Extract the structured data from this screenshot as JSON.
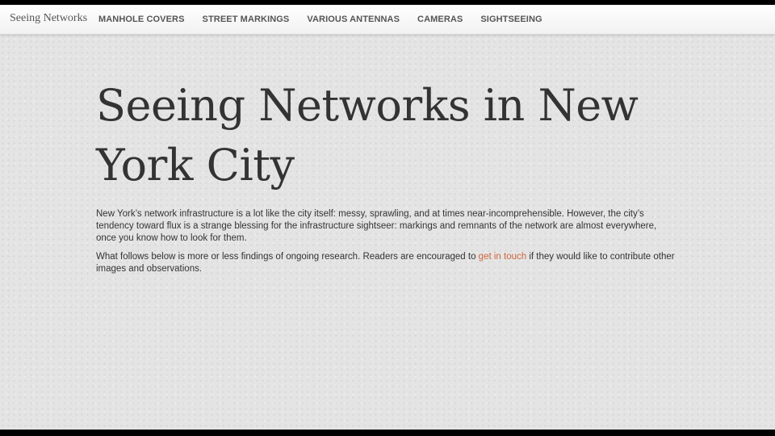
{
  "navbar": {
    "brand": "Seeing Networks",
    "items": [
      {
        "label": "MANHOLE COVERS"
      },
      {
        "label": "STREET MARKINGS"
      },
      {
        "label": "VARIOUS ANTENNAS"
      },
      {
        "label": "CAMERAS"
      },
      {
        "label": "SIGHTSEEING"
      }
    ]
  },
  "main": {
    "title": "Seeing Networks in New York City",
    "intro": "New York’s network infrastructure is a lot like the city itself: messy, sprawling, and at times near-incomprehensible. However, the city’s tendency toward flux is a strange blessing for the infrastructure sightseer: markings and remnants of the network are almost everywhere, once you know how to look for them.",
    "followup_before": "What follows below is more or less findings of ongoing research. Readers are encouraged to ",
    "followup_link": "get in touch",
    "followup_after": " if they would like to contribute other images and observations."
  },
  "colors": {
    "background": "#e4e4e4",
    "text": "#333333",
    "link": "#d0683e",
    "navbar": "#f7f7f7"
  }
}
